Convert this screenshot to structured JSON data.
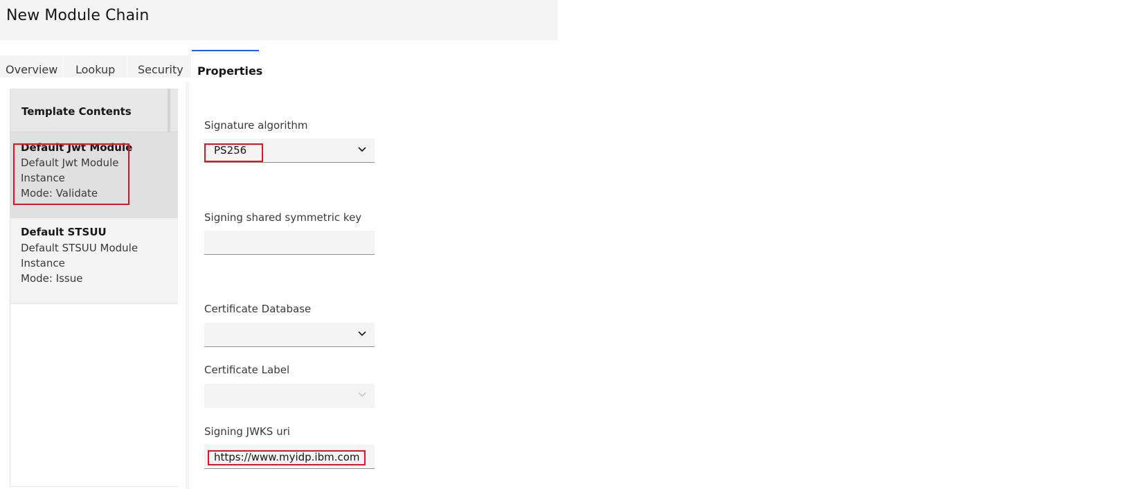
{
  "header": {
    "title": "New Module Chain"
  },
  "tabs": [
    {
      "label": "Overview"
    },
    {
      "label": "Lookup"
    },
    {
      "label": "Security"
    },
    {
      "label": "Properties"
    }
  ],
  "template_panel": {
    "title": "Template Contents",
    "items": [
      {
        "name": "Default Jwt Module",
        "line1": "Default Jwt Module",
        "line2": "Instance",
        "line3": "Mode: Validate"
      },
      {
        "name": "Default STSUU",
        "line1": "Default STSUU Module",
        "line2": "Instance",
        "line3": "Mode: Issue"
      }
    ]
  },
  "properties": {
    "signature_algorithm": {
      "label": "Signature algorithm",
      "value": "PS256"
    },
    "signing_shared_key": {
      "label": "Signing shared symmetric key",
      "value": ""
    },
    "certificate_database": {
      "label": "Certificate Database",
      "value": ""
    },
    "certificate_label": {
      "label": "Certificate Label",
      "value": ""
    },
    "signing_jwks_uri": {
      "label": "Signing JWKS uri",
      "value": "https://www.myidp.ibm.com"
    }
  },
  "colors": {
    "highlight": "#e0141e",
    "active_tab_accent": "#0f62fe"
  }
}
